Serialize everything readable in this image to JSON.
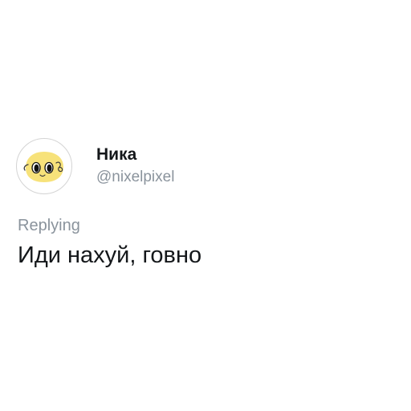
{
  "tweet": {
    "avatar_icon": "yellow-blob-face-icon",
    "display_name": "Ника",
    "handle": "@nixelpixel",
    "replying_label": "Replying",
    "text": "Иди нахуй, говно"
  },
  "colors": {
    "background": "#ffffff",
    "name": "#14171a",
    "muted": "#8a939c",
    "avatar_face": "#f7e27a"
  }
}
